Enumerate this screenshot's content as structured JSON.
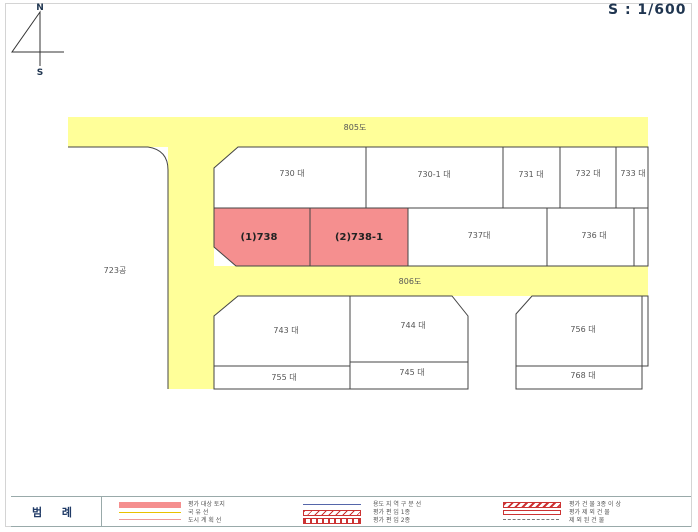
{
  "map": {
    "scale_label": "S : 1/600",
    "north_label": "N",
    "south_label": "S",
    "colors": {
      "road": "#ffff99",
      "target_parcel": "#f58f8f",
      "parcel_line": "#444444",
      "parcel_fill": "#ffffff",
      "legend_title": "#1f3a66"
    },
    "roads": [
      {
        "id": "road-top",
        "label": "805도"
      },
      {
        "id": "road-middle",
        "label": "806도"
      },
      {
        "id": "road-left",
        "label": "723공"
      }
    ],
    "parcels": [
      {
        "id": "730",
        "label": "730 대",
        "target": false
      },
      {
        "id": "730-1",
        "label": "730-1 대",
        "target": false
      },
      {
        "id": "731",
        "label": "731 대",
        "target": false
      },
      {
        "id": "732",
        "label": "732 대",
        "target": false
      },
      {
        "id": "733",
        "label": "733 대",
        "target": false
      },
      {
        "id": "738",
        "label": "(1)738",
        "target": true
      },
      {
        "id": "738-1",
        "label": "(2)738-1",
        "target": true
      },
      {
        "id": "737",
        "label": "737대",
        "target": false
      },
      {
        "id": "736",
        "label": "736 대",
        "target": false
      },
      {
        "id": "743",
        "label": "743 대",
        "target": false
      },
      {
        "id": "744",
        "label": "744 대",
        "target": false
      },
      {
        "id": "756",
        "label": "756 대",
        "target": false
      },
      {
        "id": "755",
        "label": "755 대",
        "target": false
      },
      {
        "id": "745",
        "label": "745 대",
        "target": false
      },
      {
        "id": "768",
        "label": "768 대",
        "target": false
      }
    ]
  },
  "legend": {
    "title": "범 례",
    "items": [
      {
        "id": "target-land",
        "label": "평가 대상 토지"
      },
      {
        "id": "road-line",
        "label": "국 유 선"
      },
      {
        "id": "city-plan-line",
        "label": "도시 계 획 선"
      },
      {
        "id": "urban-boundary",
        "label": "용도 지 역 구 분 선"
      },
      {
        "id": "eval-plan-1",
        "label": "평가 편 입 1종"
      },
      {
        "id": "eval-plan-2",
        "label": "평가 편 입 2종"
      },
      {
        "id": "eval-target-3",
        "label": "평가 건 물 3종 이 상"
      },
      {
        "id": "eval-exclude",
        "label": "평가 제 외 건 물"
      },
      {
        "id": "excluded-building",
        "label": "제 외 된 건 물"
      }
    ]
  }
}
